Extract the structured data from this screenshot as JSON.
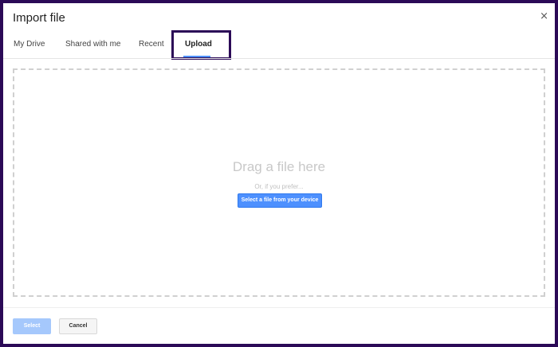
{
  "dialog": {
    "title": "Import file",
    "close_glyph": "×"
  },
  "tabs": [
    {
      "label": "My Drive"
    },
    {
      "label": "Shared with me"
    },
    {
      "label": "Recent"
    },
    {
      "label": "Upload",
      "active": true
    }
  ],
  "dropzone": {
    "drag_text": "Drag a file here",
    "or_text": "Or, if you prefer...",
    "select_button": "Select a file from your device"
  },
  "footer": {
    "select_label": "Select",
    "cancel_label": "Cancel"
  },
  "colors": {
    "accent": "#4d90fe",
    "frame": "#2b0a57",
    "disabled_accent": "#a5c8fc"
  },
  "icons": {
    "close": "close-icon"
  }
}
